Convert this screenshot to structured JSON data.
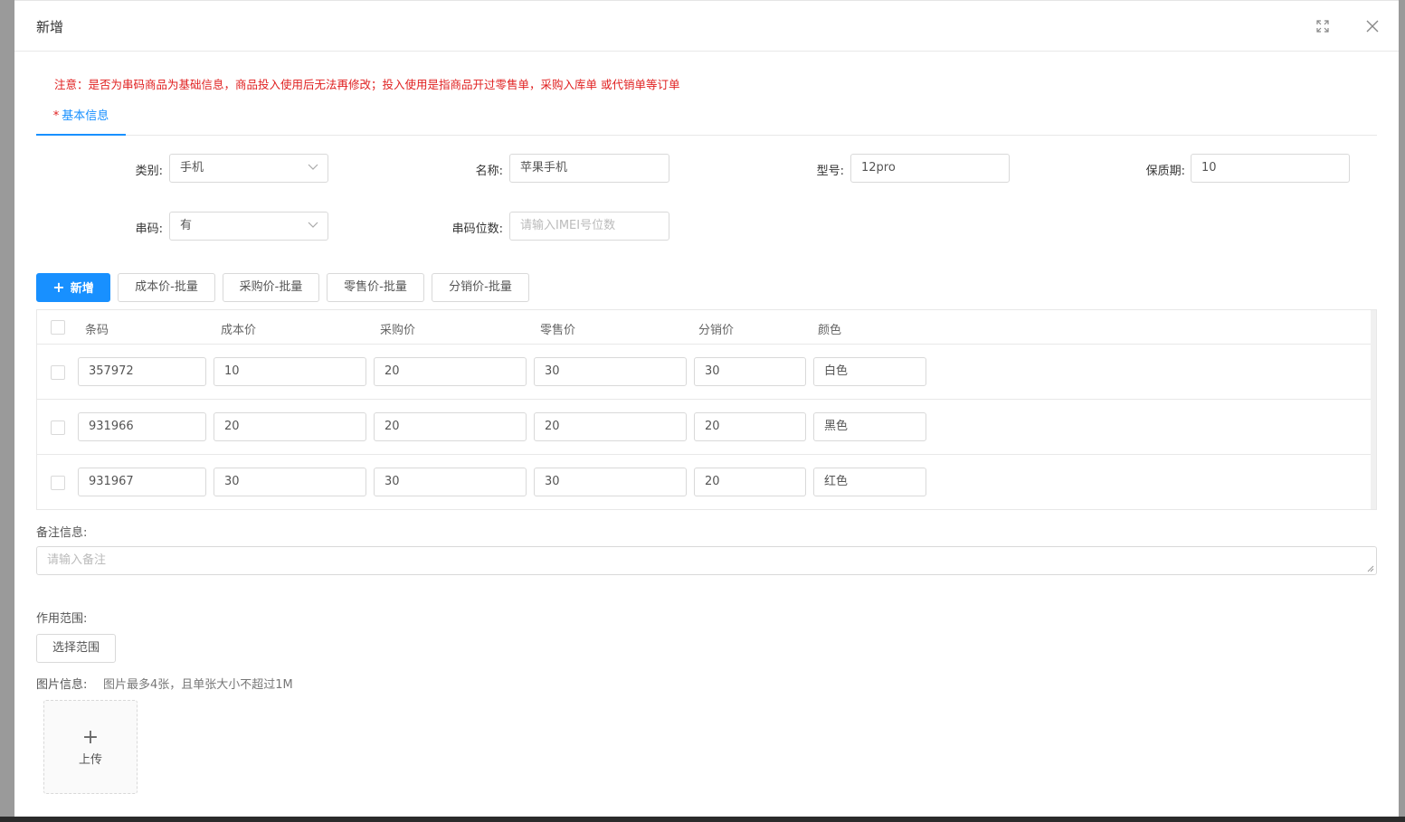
{
  "modal": {
    "title": "新增"
  },
  "notice": "注意：是否为串码商品为基础信息，商品投入使用后无法再修改；投入使用是指商品开过零售单，采购入库单 或代销单等订单",
  "tabs": [
    {
      "label": "基本信息",
      "required_mark": "*",
      "active": true
    }
  ],
  "form": {
    "category": {
      "label": "类别:",
      "value": "手机"
    },
    "name": {
      "label": "名称:",
      "value": "苹果手机"
    },
    "model": {
      "label": "型号:",
      "value": "12pro"
    },
    "shelf_life": {
      "label": "保质期:",
      "value": "10"
    },
    "serial": {
      "label": "串码:",
      "value": "有"
    },
    "serial_digits": {
      "label": "串码位数:",
      "placeholder": "请输入IMEI号位数"
    }
  },
  "toolbar": {
    "add_icon": "plus-icon",
    "add_label": "新增",
    "cost_batch": "成本价-批量",
    "purchase_batch": "采购价-批量",
    "retail_batch": "零售价-批量",
    "distribution_batch": "分销价-批量"
  },
  "table": {
    "columns": [
      "条码",
      "成本价",
      "采购价",
      "零售价",
      "分销价",
      "颜色"
    ],
    "rows": [
      {
        "barcode": "357972",
        "cost": "10",
        "purchase": "20",
        "retail": "30",
        "distribution": "30",
        "color": "白色"
      },
      {
        "barcode": "931966",
        "cost": "20",
        "purchase": "20",
        "retail": "20",
        "distribution": "20",
        "color": "黑色"
      },
      {
        "barcode": "931967",
        "cost": "30",
        "purchase": "30",
        "retail": "30",
        "distribution": "20",
        "color": "红色"
      }
    ]
  },
  "remark": {
    "label": "备注信息:",
    "placeholder": "请输入备注"
  },
  "scope": {
    "label": "作用范围:",
    "button": "选择范围"
  },
  "images": {
    "label": "图片信息:",
    "hint": "图片最多4张，且单张大小不超过1M",
    "upload_label": "上传",
    "upload_icon": "plus-icon"
  },
  "colors": {
    "primary": "#1890ff",
    "notice": "#e02020"
  }
}
